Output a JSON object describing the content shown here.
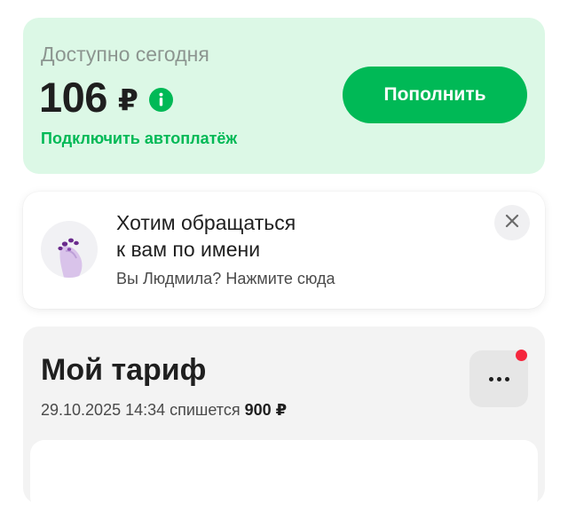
{
  "balance": {
    "label": "Доступно сегодня",
    "amount": "106",
    "currency": "₽",
    "autopay_link": "Подключить автоплатёж",
    "topup_button": "Пополнить"
  },
  "name_prompt": {
    "title_line1": "Хотим обращаться",
    "title_line2": "к вам по имени",
    "subtitle": "Вы Людмила? Нажмите сюда"
  },
  "tariff": {
    "title": "Мой тариф",
    "charge_date": "29.10.2025 14:34 спишется",
    "charge_amount": "900 ₽"
  },
  "colors": {
    "accent": "#00b956",
    "balance_bg": "#dcf8e6",
    "notification": "#f5263d"
  },
  "icons": {
    "info": "info-icon",
    "close": "close-icon",
    "more": "more-dots-icon",
    "avatar": "cat-paw-icon"
  }
}
